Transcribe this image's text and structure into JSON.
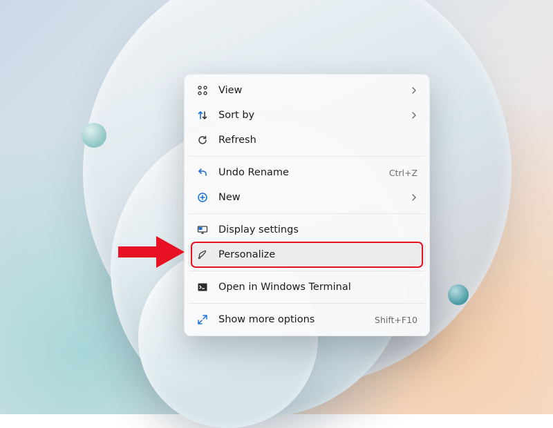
{
  "menu": {
    "groups": [
      {
        "items": [
          {
            "id": "view",
            "icon": "grid",
            "label": "View",
            "submenu": true
          },
          {
            "id": "sort",
            "icon": "sort",
            "label": "Sort by",
            "submenu": true
          },
          {
            "id": "refresh",
            "icon": "refresh",
            "label": "Refresh"
          }
        ]
      },
      {
        "items": [
          {
            "id": "undo",
            "icon": "undo",
            "label": "Undo Rename",
            "accel": "Ctrl+Z"
          },
          {
            "id": "new",
            "icon": "plus",
            "label": "New",
            "submenu": true
          }
        ]
      },
      {
        "items": [
          {
            "id": "display",
            "icon": "display",
            "label": "Display settings"
          },
          {
            "id": "personalize",
            "icon": "brush",
            "label": "Personalize",
            "highlighted": true
          }
        ]
      },
      {
        "items": [
          {
            "id": "terminal",
            "icon": "terminal",
            "label": "Open in Windows Terminal"
          }
        ]
      },
      {
        "items": [
          {
            "id": "more",
            "icon": "expand",
            "label": "Show more options",
            "accel": "Shift+F10"
          }
        ]
      }
    ]
  },
  "annotation": {
    "arrow_color": "#e81123",
    "highlight_color": "#e81123"
  }
}
